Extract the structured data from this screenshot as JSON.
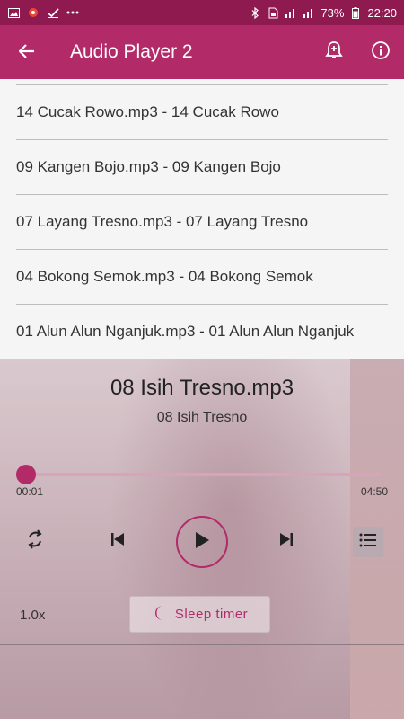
{
  "status_bar": {
    "battery": "73%",
    "time": "22:20",
    "left_icons": [
      "image-icon",
      "notification-icon",
      "check-icon",
      "more-dots-icon"
    ],
    "right_icons": [
      "bluetooth-icon",
      "sim-icon",
      "signal-icon",
      "signal-icon",
      "battery-icon"
    ]
  },
  "app_bar": {
    "title": "Audio Player 2",
    "actions": [
      "add-alarm-icon",
      "info-icon"
    ]
  },
  "playlist": {
    "items": [
      "14 Cucak Rowo.mp3 - 14 Cucak Rowo",
      "09 Kangen Bojo.mp3 - 09 Kangen Bojo",
      "07 Layang Tresno.mp3 - 07 Layang Tresno",
      "04 Bokong Semok.mp3 - 04 Bokong Semok",
      "01 Alun Alun Nganjuk.mp3 - 01 Alun Alun Nganjuk"
    ]
  },
  "player": {
    "track_title": "08 Isih Tresno.mp3",
    "track_subtitle": "08 Isih Tresno",
    "current_time": "00:01",
    "total_time": "04:50",
    "progress_fraction": 0.0034,
    "speed": "1.0x",
    "sleep_timer_label": "Sleep timer"
  },
  "colors": {
    "accent": "#b32a68",
    "status_bar": "#8e1a4f",
    "track": "#d8a3bb"
  }
}
